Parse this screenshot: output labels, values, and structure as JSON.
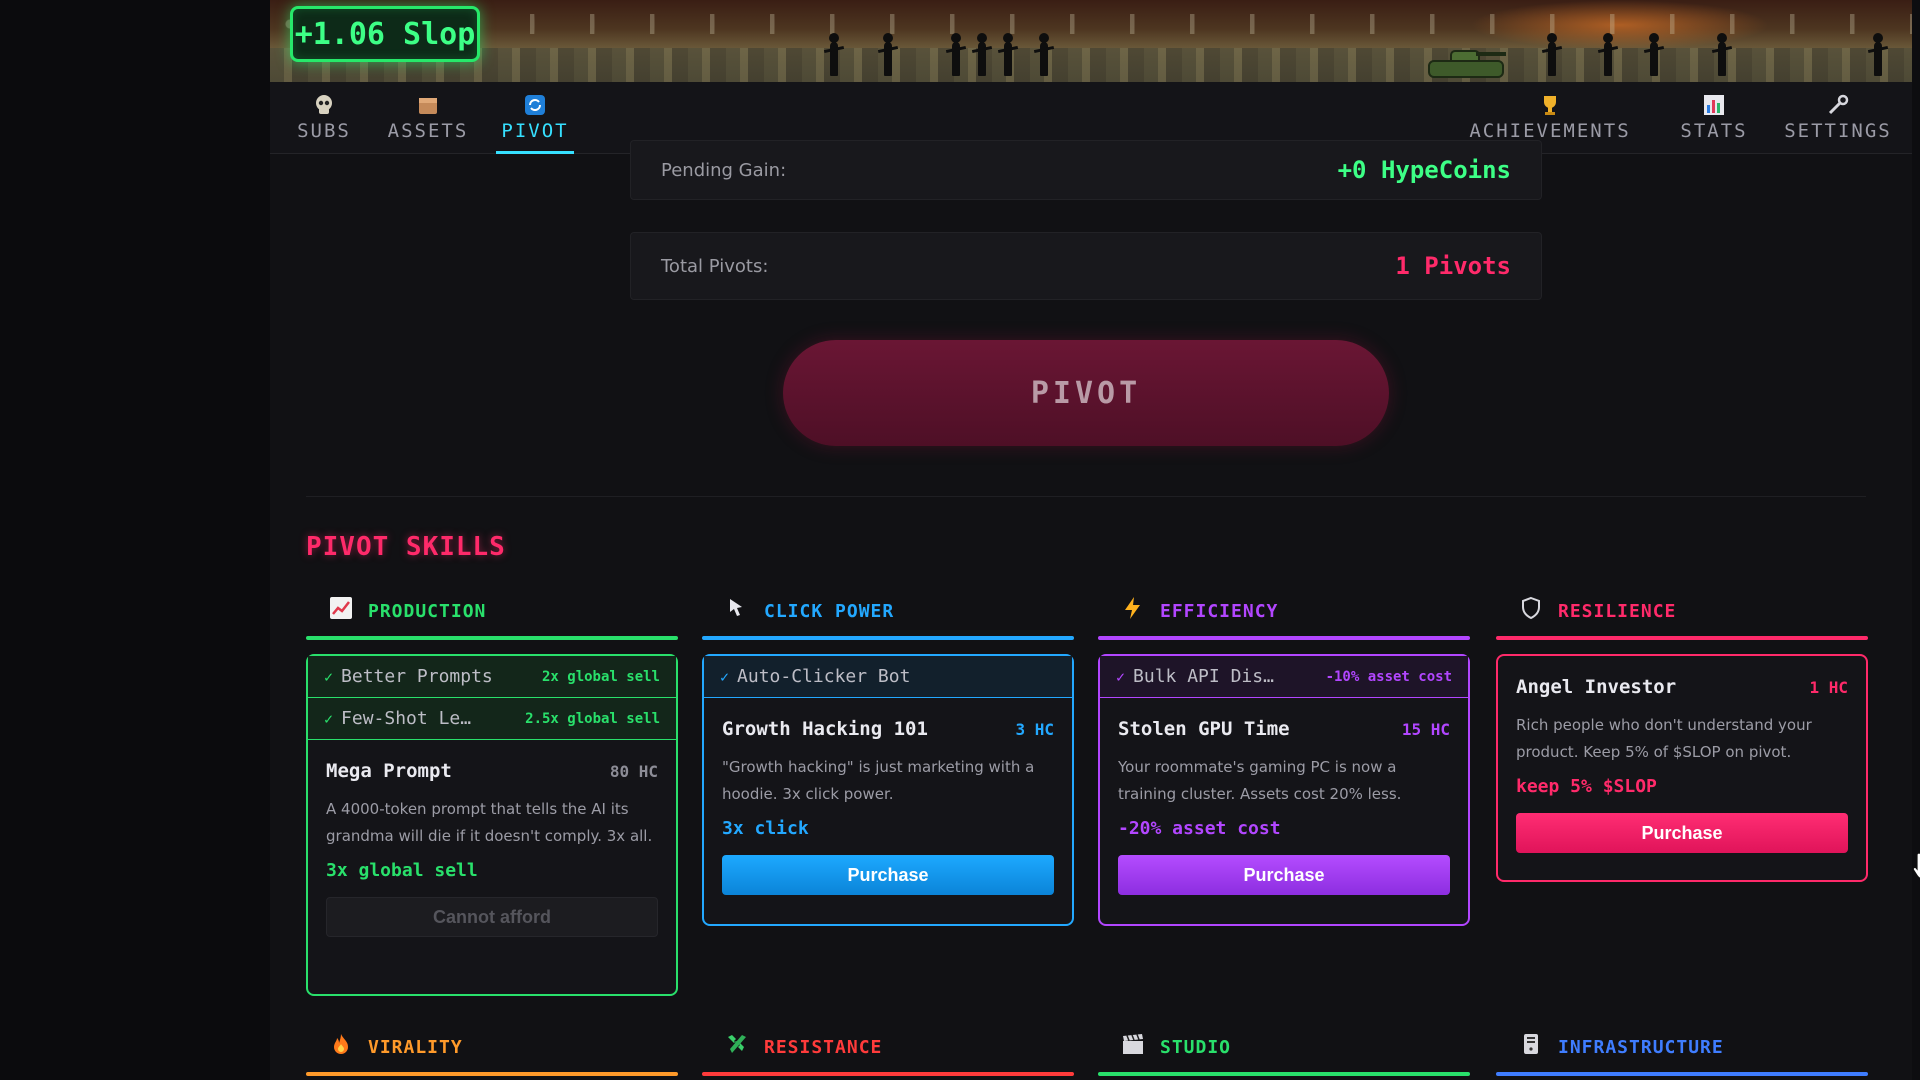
{
  "header": {
    "slop_counter": "+1.06 Slop"
  },
  "nav": {
    "left": [
      {
        "label": "SUBS",
        "icon": "skull-icon"
      },
      {
        "label": "ASSETS",
        "icon": "box-icon"
      },
      {
        "label": "PIVOT",
        "icon": "cycle-icon",
        "active": true
      }
    ],
    "right": [
      {
        "label": "ACHIEVEMENTS",
        "icon": "trophy-icon"
      },
      {
        "label": "STATS",
        "icon": "bar-chart-icon"
      },
      {
        "label": "SETTINGS",
        "icon": "wrench-icon"
      }
    ]
  },
  "pivot_panel": {
    "pending_label": "Pending Gain:",
    "pending_value": "+0 HypeCoins",
    "total_label": "Total Pivots:",
    "total_value": "1 Pivots",
    "pivot_button": "PIVOT"
  },
  "skills": {
    "title": "PIVOT SKILLS",
    "columns": [
      {
        "name": "PRODUCTION",
        "icon": "chart-up-icon",
        "color": "#29e06b",
        "owned": [
          {
            "name": "Better Prompts",
            "effect": "2x global sell"
          },
          {
            "name": "Few-Shot Le…",
            "effect": "2.5x global sell"
          }
        ],
        "card": {
          "name": "Mega Prompt",
          "cost": "80 HC",
          "desc": "A 4000-token prompt that tells the AI its grandma will die if it doesn't comply. 3x all.",
          "effect": "3x global sell",
          "button": "Cannot afford",
          "affordable": false
        }
      },
      {
        "name": "CLICK POWER",
        "icon": "pointer-icon",
        "color": "#23a8ff",
        "owned": [
          {
            "name": "Auto-Clicker Bot",
            "effect": ""
          }
        ],
        "card": {
          "name": "Growth Hacking 101",
          "cost": "3 HC",
          "desc": "\"Growth hacking\" is just marketing with a hoodie. 3x click power.",
          "effect": "3x click",
          "button": "Purchase",
          "affordable": true
        }
      },
      {
        "name": "EFFICIENCY",
        "icon": "lightning-icon",
        "color": "#b246ff",
        "owned": [
          {
            "name": "Bulk API Dis…",
            "effect": "-10% asset cost"
          }
        ],
        "card": {
          "name": "Stolen GPU Time",
          "cost": "15 HC",
          "desc": "Your roommate's gaming PC is now a training cluster. Assets cost 20% less.",
          "effect": "-20% asset cost",
          "button": "Purchase",
          "affordable": true
        }
      },
      {
        "name": "RESILIENCE",
        "icon": "shield-icon",
        "color": "#ff2a6a",
        "owned": [],
        "card": {
          "name": "Angel Investor",
          "cost": "1 HC",
          "desc": "Rich people who don't understand your product. Keep 5% of $SLOP on pivot.",
          "effect": "keep 5% $SLOP",
          "button": "Purchase",
          "affordable": true
        }
      }
    ],
    "bottom_columns": [
      {
        "name": "VIRALITY",
        "icon": "fire-icon",
        "color": "#ff9a2a"
      },
      {
        "name": "RESISTANCE",
        "icon": "puzzle-icon",
        "color": "#ff3b3b"
      },
      {
        "name": "STUDIO",
        "icon": "clapper-icon",
        "color": "#29e06b"
      },
      {
        "name": "INFRASTRUCTURE",
        "icon": "server-icon",
        "color": "#3f7dff"
      }
    ]
  }
}
